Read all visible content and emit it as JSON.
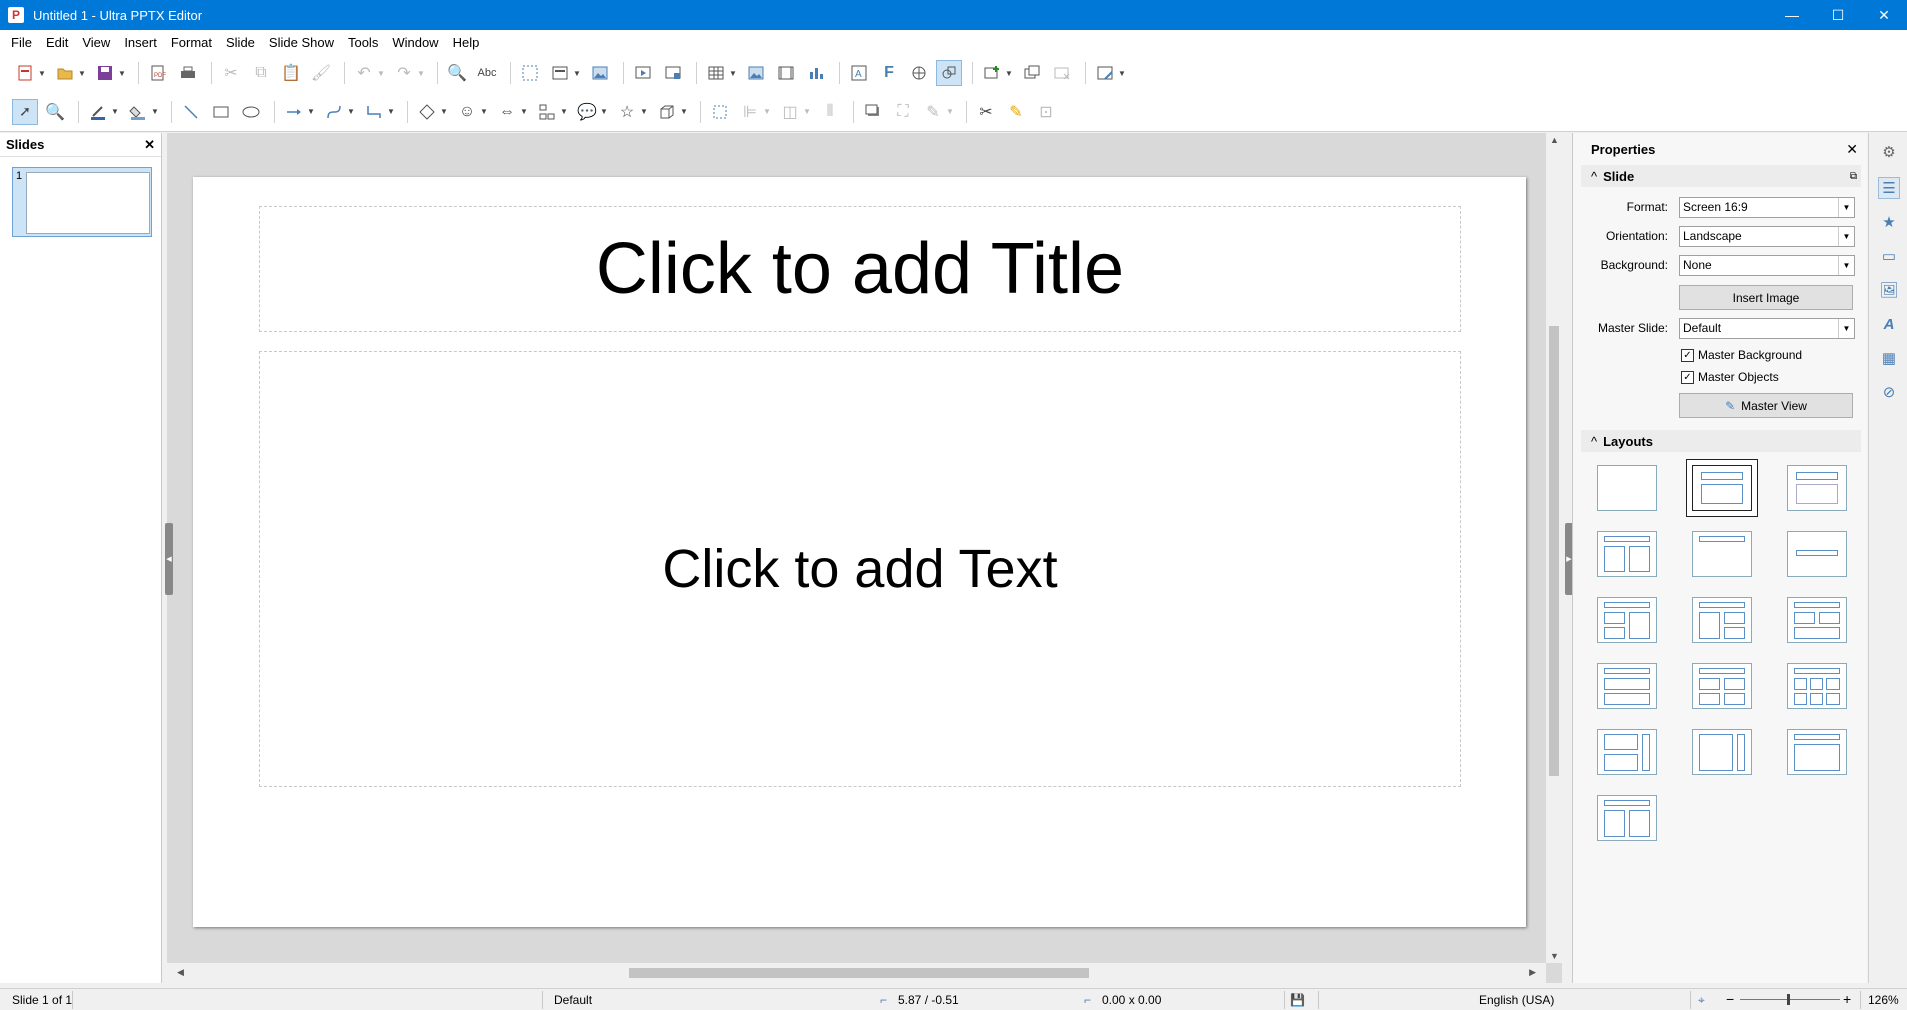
{
  "window": {
    "title": "Untitled 1 - Ultra PPTX Editor",
    "app_icon_letter": "P",
    "minimize": "—",
    "maximize": "☐",
    "close": "✕"
  },
  "menu": [
    "File",
    "Edit",
    "View",
    "Insert",
    "Format",
    "Slide",
    "Slide Show",
    "Tools",
    "Window",
    "Help"
  ],
  "slides_pane": {
    "title": "Slides",
    "close": "✕",
    "thumbnail_number": "1"
  },
  "slide": {
    "title_placeholder": "Click to add Title",
    "text_placeholder": "Click to add Text"
  },
  "properties": {
    "title": "Properties",
    "close": "✕",
    "slide_section": "Slide",
    "format_label": "Format:",
    "format_value": "Screen 16:9",
    "orientation_label": "Orientation:",
    "orientation_value": "Landscape",
    "background_label": "Background:",
    "background_value": "None",
    "insert_image": "Insert Image",
    "master_slide_label": "Master Slide:",
    "master_slide_value": "Default",
    "master_background": "Master Background",
    "master_objects": "Master Objects",
    "master_view": "Master View",
    "layouts_section": "Layouts",
    "collapse_glyph": "^",
    "dropdown_glyph": "▼",
    "check_glyph": "✓"
  },
  "status": {
    "slide_of": "Slide 1 of 1",
    "master": "Default",
    "position": "5.87 / -0.51",
    "size": "0.00 x 0.00",
    "language": "English (USA)",
    "zoom_minus": "−",
    "zoom_plus": "+",
    "zoom": "126%"
  }
}
